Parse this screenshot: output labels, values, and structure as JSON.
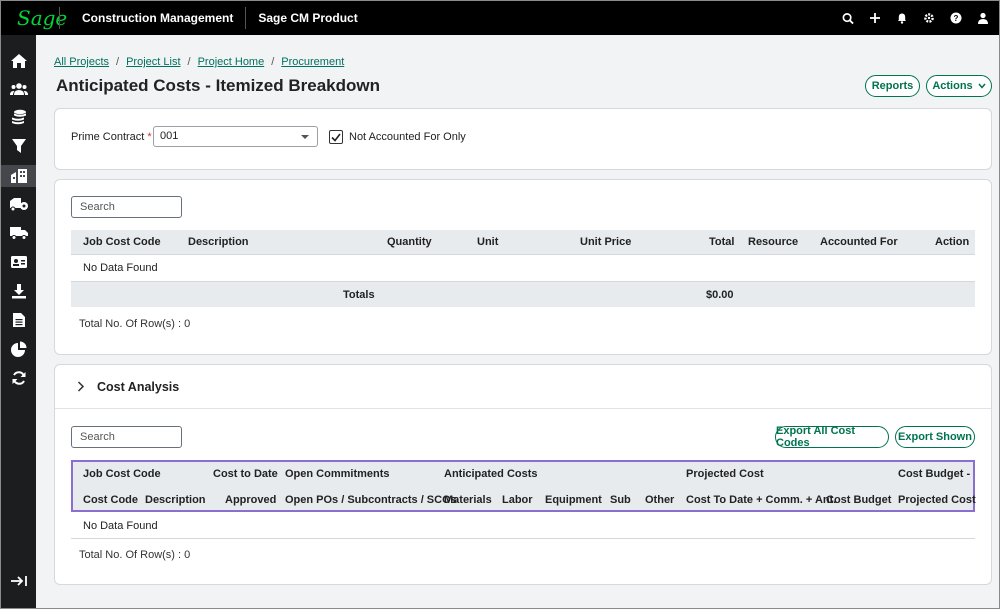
{
  "app": {
    "logo": "Sage",
    "title": "Construction Management",
    "product": "Sage CM Product"
  },
  "topbar_icons": [
    "search-icon",
    "plus-icon",
    "bell-icon",
    "gear-icon",
    "help-icon",
    "user-icon"
  ],
  "sidebar_icons": [
    "home-icon",
    "people-icon",
    "database-icon",
    "filter-icon",
    "buildings-icon",
    "truck-gear-icon",
    "delivery-truck-icon",
    "id-card-icon",
    "download-icon",
    "document-icon",
    "pie-chart-icon",
    "refresh-icon",
    "collapse-sidebar-icon"
  ],
  "breadcrumb": [
    "All Projects",
    "Project List",
    "Project Home",
    "Procurement"
  ],
  "breadcrumb_sep": "/",
  "page_title": "Anticipated Costs - Itemized Breakdown",
  "header_buttons": {
    "reports": "Reports",
    "actions": "Actions"
  },
  "filters": {
    "prime_contract_label": "Prime Contract",
    "required_mark": "*",
    "prime_contract_value": "001",
    "not_accounted_label": "Not Accounted For Only",
    "not_accounted_checked": true
  },
  "itemized": {
    "search_placeholder": "Search",
    "columns": [
      "Job Cost Code",
      "Description",
      "Quantity",
      "Unit",
      "Unit Price",
      "Total",
      "Resource",
      "Accounted For",
      "Action"
    ],
    "empty_text": "No Data Found",
    "totals_label": "Totals",
    "totals_value": "$0.00",
    "row_count": "Total No. Of Row(s) : 0"
  },
  "cost_analysis": {
    "title": "Cost Analysis",
    "search_placeholder": "Search",
    "export_all": "Export All Cost Codes",
    "export_shown": "Export Shown",
    "group_headers": [
      "Job Cost Code",
      "Cost to Date",
      "Open Commitments",
      "Anticipated Costs",
      "Projected Cost",
      "Cost Budget -"
    ],
    "sub_headers": [
      "Cost Code",
      "Description",
      "Approved",
      "Open POs / Subcontracts / SCOs",
      "Materials",
      "Labor",
      "Equipment",
      "Sub",
      "Other",
      "Cost To Date + Comm. + Ant.",
      "Cost Budget",
      "Projected Cost"
    ],
    "empty_text": "No Data Found",
    "row_count": "Total No. Of Row(s) : 0"
  },
  "colors": {
    "brand_green": "#00d639",
    "accent": "#00734f",
    "highlight_border": "#8a6fd0"
  }
}
